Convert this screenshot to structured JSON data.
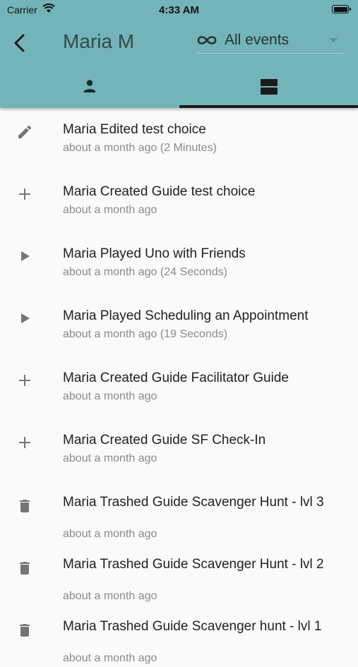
{
  "status_bar": {
    "carrier": "Carrier",
    "time": "4:33 AM"
  },
  "header": {
    "title": "Maria M",
    "filter": {
      "selected": "All events",
      "icon": "infinity-icon"
    },
    "tabs": [
      {
        "name": "profile",
        "icon": "person-icon"
      },
      {
        "name": "events",
        "icon": "list-view-icon",
        "selected": true
      }
    ]
  },
  "events": [
    {
      "icon": "edit-icon",
      "title": "Maria Edited test choice",
      "subtitle": "about a month ago (2 Minutes)"
    },
    {
      "icon": "add-icon",
      "title": "Maria Created Guide test choice",
      "subtitle": "about a month ago"
    },
    {
      "icon": "play-icon",
      "title": "Maria Played Uno with Friends",
      "subtitle": "about a month ago (24 Seconds)"
    },
    {
      "icon": "play-icon",
      "title": "Maria Played Scheduling an Appointment",
      "subtitle": "about a month ago (19 Seconds)"
    },
    {
      "icon": "add-icon",
      "title": "Maria Created Guide Facilitator Guide",
      "subtitle": "about a month ago"
    },
    {
      "icon": "add-icon",
      "title": "Maria Created Guide SF Check-In",
      "subtitle": "about a month ago"
    },
    {
      "icon": "trash-icon",
      "title": "Maria Trashed Guide Scavenger Hunt - lvl 3",
      "subtitle": "about a month ago"
    },
    {
      "icon": "trash-icon",
      "title": "Maria Trashed Guide Scavenger Hunt - lvl 2",
      "subtitle": "about a month ago"
    },
    {
      "icon": "trash-icon",
      "title": "Maria Trashed Guide Scavenger hunt - lvl 1",
      "subtitle": "about a month ago"
    }
  ],
  "colors": {
    "header_bg": "#72b4b9",
    "list_bg": "#fafafa",
    "icon": "#757575",
    "secondary_text": "#8a8a8a"
  }
}
